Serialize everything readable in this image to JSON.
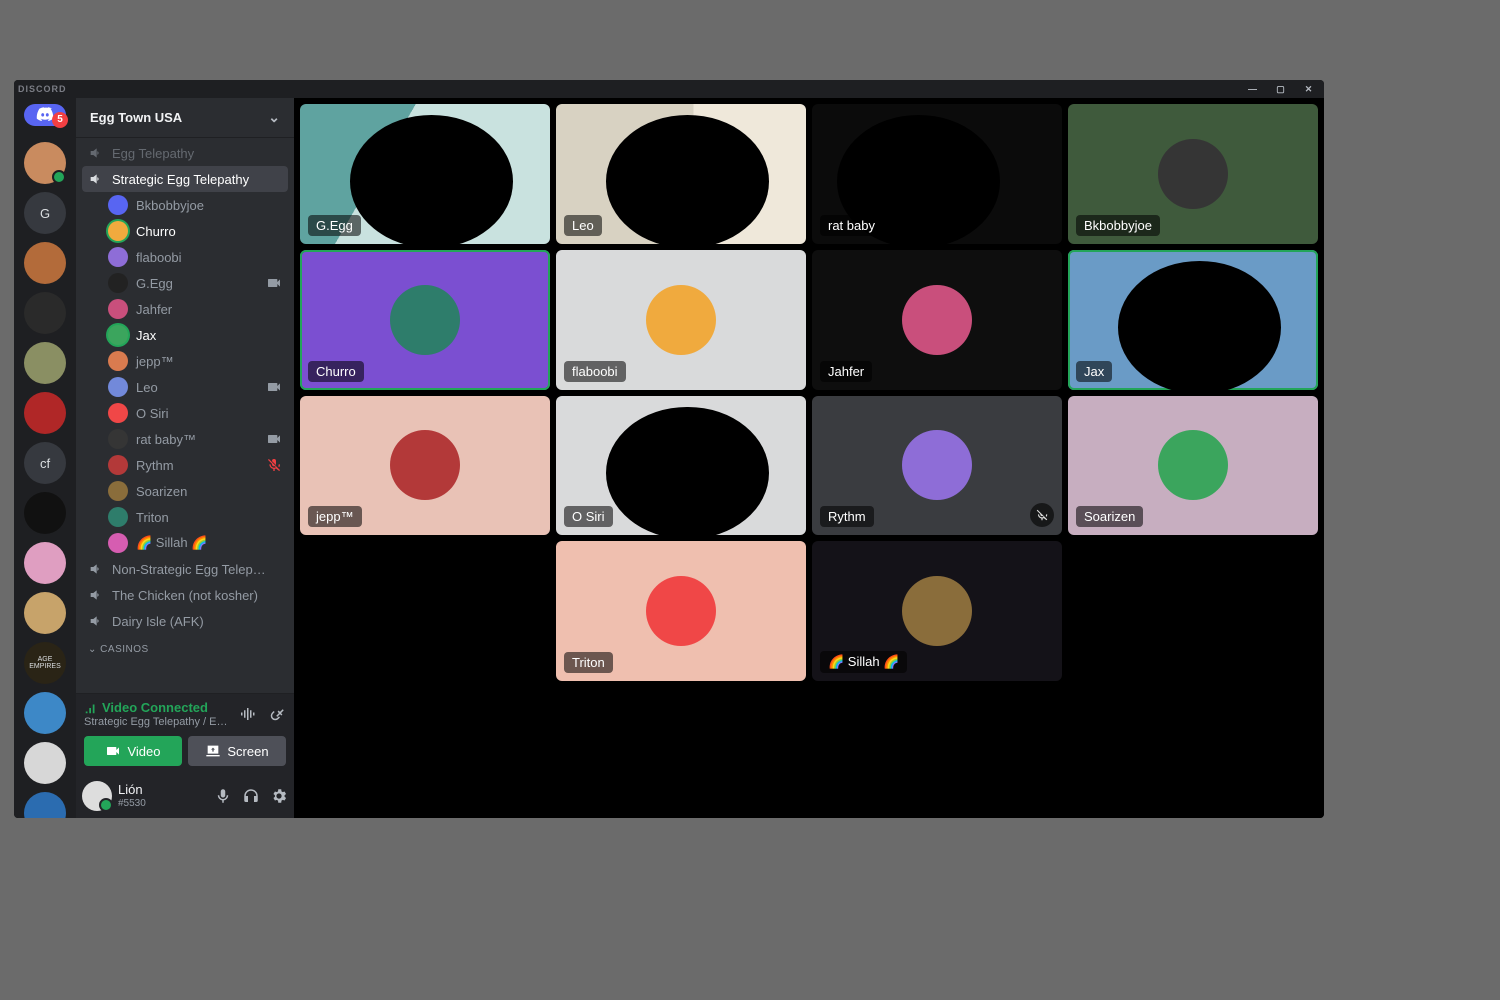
{
  "app": {
    "name": "DISCORD"
  },
  "server": {
    "name": "Egg Town USA",
    "home_badge": "5"
  },
  "rail": [
    {
      "label": "",
      "type": "home"
    },
    {
      "label": "",
      "online": true
    },
    {
      "label": "G"
    },
    {
      "label": ""
    },
    {
      "label": ""
    },
    {
      "label": ""
    },
    {
      "label": ""
    },
    {
      "label": "cf"
    },
    {
      "label": ""
    },
    {
      "label": ""
    },
    {
      "label": ""
    },
    {
      "label": "AGE\nEMPIRES"
    },
    {
      "label": ""
    },
    {
      "label": ""
    },
    {
      "label": ""
    }
  ],
  "channels": {
    "above": {
      "name": "Egg Telepathy"
    },
    "current": {
      "name": "Strategic Egg Telepathy"
    },
    "members": [
      {
        "name": "Bkbobbyjoe"
      },
      {
        "name": "Churro",
        "speaking": true
      },
      {
        "name": "flaboobi"
      },
      {
        "name": "G.Egg",
        "camera": true
      },
      {
        "name": "Jahfer"
      },
      {
        "name": "Jax",
        "speaking": true
      },
      {
        "name": "jepp™"
      },
      {
        "name": "Leo",
        "camera": true
      },
      {
        "name": "O Siri"
      },
      {
        "name": "rat baby™",
        "camera": true
      },
      {
        "name": "Rythm",
        "muted": true
      },
      {
        "name": "Soarizen"
      },
      {
        "name": "Triton"
      },
      {
        "name": "🌈 Sillah 🌈"
      }
    ],
    "below": [
      {
        "name": "Non-Strategic Egg Telep…"
      },
      {
        "name": "The Chicken (not kosher)"
      },
      {
        "name": "Dairy Isle (AFK)"
      }
    ],
    "category": "CASINOS"
  },
  "voice": {
    "status": "Video Connected",
    "sub": "Strategic Egg Telepathy / E…",
    "video_label": "Video",
    "screen_label": "Screen"
  },
  "user": {
    "name": "Lión",
    "tag": "#5530"
  },
  "tiles": [
    {
      "name": "G.Egg",
      "bg": "cam1",
      "blob": true
    },
    {
      "name": "Leo",
      "bg": "cam2",
      "blob": true
    },
    {
      "name": "rat baby",
      "bg": "cam3",
      "blob": true
    },
    {
      "name": "Bkbobbyjoe",
      "bg": "#3f5a3c",
      "avatar": true
    },
    {
      "name": "Churro",
      "bg": "#7b4fd1",
      "avatar": true,
      "speaking": true
    },
    {
      "name": "flaboobi",
      "bg": "#d9dadb",
      "avatar": true
    },
    {
      "name": "Jahfer",
      "bg": "#0e0e0e",
      "avatar": true
    },
    {
      "name": "Jax",
      "bg": "#6a9bc6",
      "blob": true,
      "speaking": true
    },
    {
      "name": "jepp™",
      "bg": "#e9c2b6",
      "avatar": true
    },
    {
      "name": "O Siri",
      "bg": "#d9dadb",
      "blob": true
    },
    {
      "name": "Rythm",
      "bg": "#3a3c40",
      "avatar": true,
      "muted": true
    },
    {
      "name": "Soarizen",
      "bg": "#c7aec0",
      "avatar": true
    },
    {
      "name": "Triton",
      "bg": "#efbfaf",
      "avatar": true,
      "col": 2
    },
    {
      "name": "🌈 Sillah 🌈",
      "bg": "#141218",
      "avatar": true,
      "col": 3
    }
  ],
  "avatar_colors": [
    "#5865f2",
    "#f0aa3e",
    "#8e6dd7",
    "#222",
    "#c94f7c",
    "#3ba55d",
    "#d97b4f",
    "#7289da",
    "#f04747",
    "#353535",
    "#b33939",
    "#8a6d3b",
    "#2e7d6b",
    "#d65db1"
  ]
}
